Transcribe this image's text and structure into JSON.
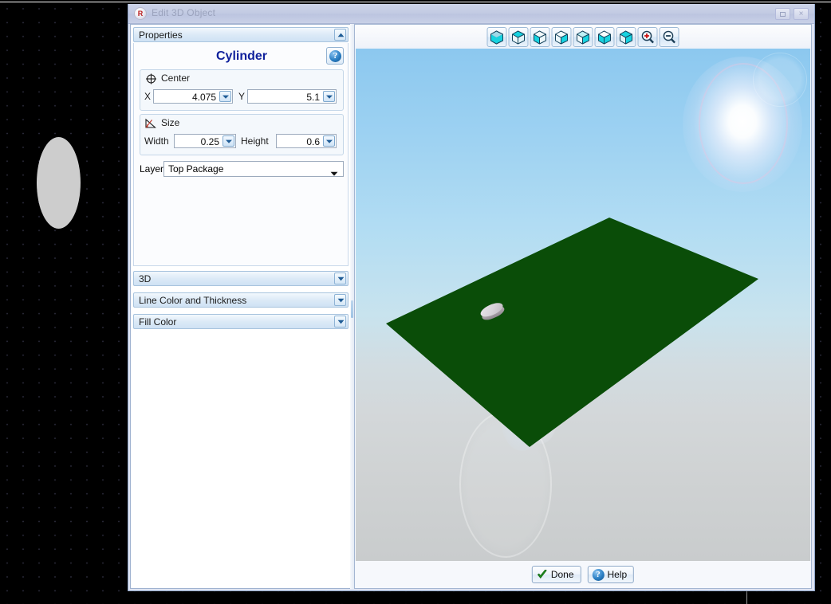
{
  "window": {
    "title": "Edit 3D Object",
    "icon": "app-icon",
    "maximize_label": "",
    "close_label": "×"
  },
  "properties_panel": {
    "header": "Properties",
    "header_state_icon": "chevron-up-icon",
    "object_title": "Cylinder",
    "help_icon": "help-icon",
    "groups": [
      {
        "name": "Center",
        "icon": "crosshair-icon",
        "fields": [
          {
            "label": "X",
            "value": "4.075"
          },
          {
            "label": "Y",
            "value": "5.1"
          }
        ]
      },
      {
        "name": "Size",
        "icon": "angle-measure-icon",
        "fields": [
          {
            "label": "Width",
            "value": "0.25"
          },
          {
            "label": "Height",
            "value": "0.6"
          }
        ]
      }
    ],
    "layer": {
      "label": "Layer",
      "value": "Top Package",
      "arrow_icon": "chevron-down-icon"
    },
    "collapsed_sections": [
      {
        "label": "3D",
        "icon": "chevron-down-icon"
      },
      {
        "label": "Line Color and Thickness",
        "icon": "chevron-down-icon"
      },
      {
        "label": "Fill Color",
        "icon": "chevron-down-icon"
      }
    ]
  },
  "viewport": {
    "toolbar": [
      {
        "name": "view-front-icon",
        "face": "front"
      },
      {
        "name": "view-top-icon",
        "face": "top"
      },
      {
        "name": "view-left-icon",
        "face": "left"
      },
      {
        "name": "view-right-icon",
        "face": "right"
      },
      {
        "name": "view-back-icon",
        "face": "back"
      },
      {
        "name": "view-bottom-icon",
        "face": "bottom"
      },
      {
        "name": "view-iso-icon",
        "face": "iso"
      },
      {
        "name": "zoom-in-icon",
        "face": "zoom-in"
      },
      {
        "name": "zoom-out-icon",
        "face": "zoom-out"
      }
    ],
    "scene": {
      "sky_top_color": "#8cc8ef",
      "sky_bottom_color": "#c9cccd",
      "plane_color": "#0a4d08",
      "object_color": "#c3bcc2",
      "sun_flare": "lens-flare"
    }
  },
  "footer": {
    "done_label": "Done",
    "done_icon": "check-icon",
    "help_label": "Help",
    "help_icon": "help-icon"
  },
  "background_canvas": {
    "shape": "ellipse",
    "shape_fill": "#cdcdcd",
    "grid": "dot-grid"
  }
}
